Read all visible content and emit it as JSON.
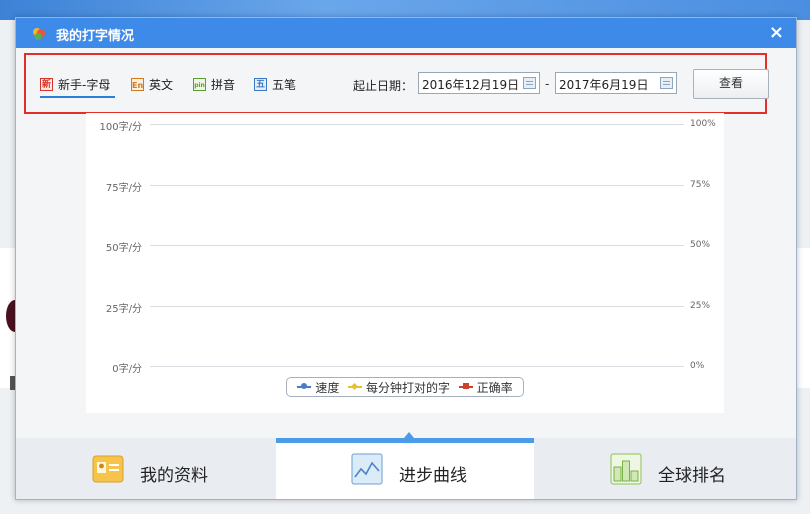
{
  "dialog": {
    "title": "我的打字情况",
    "close_symbol": "×"
  },
  "tabs": [
    {
      "badge": "新",
      "label": "新手-字母",
      "badge_color": "#d9342b",
      "active": true
    },
    {
      "badge": "En",
      "label": "英文",
      "badge_color": "#d07a1c"
    },
    {
      "badge": "pin",
      "label": "拼音",
      "badge_color": "#5aa02c"
    },
    {
      "badge": "五",
      "label": "五笔",
      "badge_color": "#3a78c2"
    }
  ],
  "date_range": {
    "label": "起止日期：",
    "start": "2016年12月19日",
    "separator": "-",
    "end": "2017年6月19日",
    "view_button": "查看"
  },
  "chart_data": {
    "type": "line",
    "title": "",
    "y_left_ticks": [
      "100字/分",
      "75字/分",
      "50字/分",
      "25字/分",
      "0字/分"
    ],
    "y_right_ticks": [
      "100%",
      "75%",
      "50%",
      "25%",
      "0%"
    ],
    "ylim_left": [
      0,
      100
    ],
    "ylim_right": [
      0,
      100
    ],
    "grid": true,
    "legend_position": "bottom-center",
    "series": [
      {
        "name": "速度",
        "color": "#4a7fc8",
        "marker": "circle",
        "values": []
      },
      {
        "name": "每分钟打对的字",
        "color": "#e8c22a",
        "marker": "diamond",
        "values": []
      },
      {
        "name": "正确率",
        "color": "#c9432e",
        "marker": "square",
        "values": []
      }
    ]
  },
  "bottom_nav": [
    {
      "label": "我的资料",
      "icon": "profile-card-icon"
    },
    {
      "label": "进步曲线",
      "icon": "progress-chart-icon",
      "active": true
    },
    {
      "label": "全球排名",
      "icon": "ranking-podium-icon"
    }
  ]
}
